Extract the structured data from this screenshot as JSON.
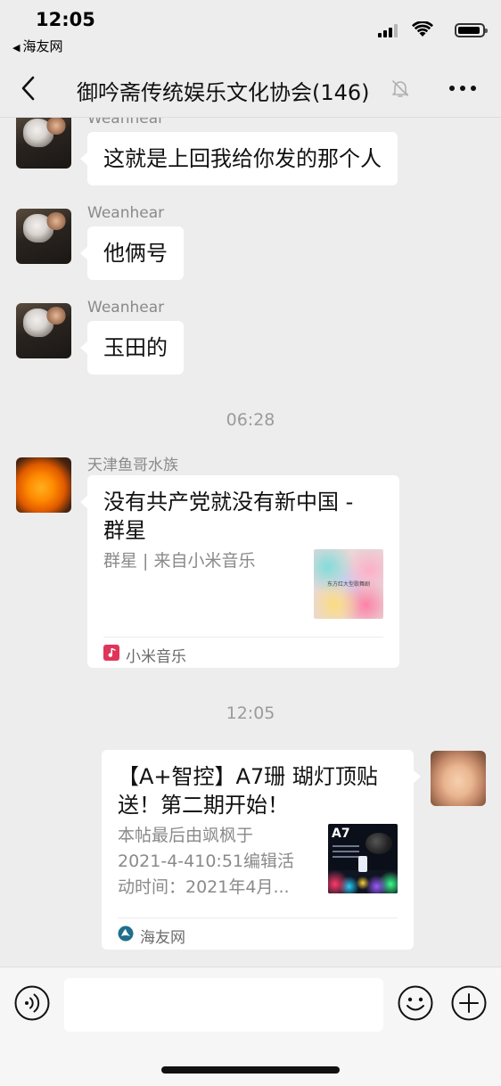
{
  "status_bar": {
    "time": "12:05",
    "back_app": "海友网"
  },
  "nav": {
    "title": "御吟斋传统娱乐文化协会(146)",
    "icons": [
      "back-arrow-icon",
      "mute-bell-icon",
      "more-icon"
    ]
  },
  "messages": [
    {
      "sender": "Weanhear",
      "text": "这就是上回我给你发的那个人"
    },
    {
      "sender": "Weanhear",
      "text": "他俩号"
    },
    {
      "sender": "Weanhear",
      "text": "玉田的"
    }
  ],
  "timestamps": [
    "06:28",
    "12:05"
  ],
  "music_card": {
    "sender": "天津鱼哥水族",
    "title_line1": "没有共产党就没有新中国 -",
    "title_line2": "群星",
    "desc": "群星 | 来自小米音乐",
    "thumb_text": "东方红大型歌舞剧",
    "source": "小米音乐",
    "source_color": "#e0355a"
  },
  "link_card": {
    "title_line1": "【A+智控】A7珊 瑚灯顶贴",
    "title_line2": "送！第二期开始！",
    "desc_line1": "本帖最后由飒枫于",
    "desc_line2": "2021-4-410:51编辑活",
    "desc_line3": "动时间：2021年4月...",
    "thumb_label": "A7",
    "source": "海友网"
  },
  "input": {
    "placeholder": "",
    "icons": [
      "voice-icon",
      "emoji-icon",
      "plus-icon"
    ]
  },
  "colors": {
    "background": "#ededed",
    "bubble": "#ffffff",
    "sender_text": "#8a8a8a"
  }
}
